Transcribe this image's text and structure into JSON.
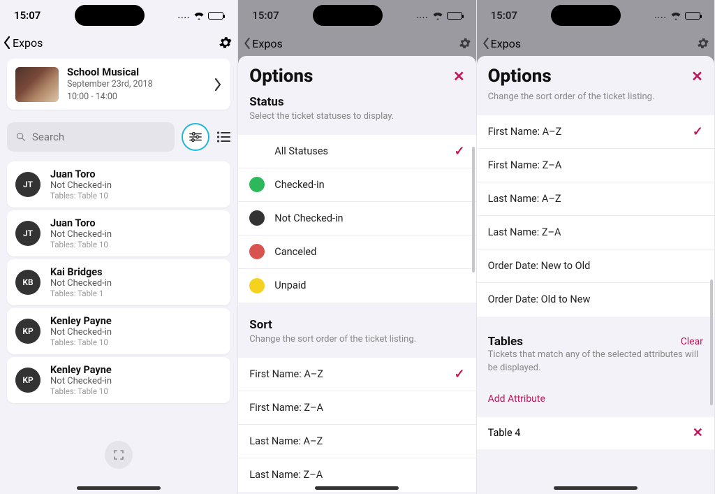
{
  "time": "15:07",
  "dots": "....",
  "screen1": {
    "back_label": "Expos",
    "event": {
      "title": "School Musical",
      "date": "September 23rd, 2018",
      "time": "10:00 - 14:00"
    },
    "search_placeholder": "Search",
    "attendees": [
      {
        "initials": "JT",
        "name": "Juan Toro",
        "status": "Not Checked-in",
        "table": "Tables: Table 10"
      },
      {
        "initials": "JT",
        "name": "Juan Toro",
        "status": "Not Checked-in",
        "table": "Tables: Table 10"
      },
      {
        "initials": "KB",
        "name": "Kai Bridges",
        "status": "Not Checked-in",
        "table": "Tables: Table 1"
      },
      {
        "initials": "KP",
        "name": "Kenley Payne",
        "status": "Not Checked-in",
        "table": "Tables: Table 10"
      },
      {
        "initials": "KP",
        "name": "Kenley Payne",
        "status": "Not Checked-in",
        "table": "Tables: Table 10"
      }
    ]
  },
  "screen2": {
    "back_label": "Expos",
    "sheet_title": "Options",
    "status_title": "Status",
    "status_sub": "Select the ticket statuses to display.",
    "status_opts": [
      {
        "label": "All Statuses",
        "color": "none",
        "selected": true
      },
      {
        "label": "Checked-in",
        "color": "green",
        "selected": false
      },
      {
        "label": "Not Checked-in",
        "color": "black",
        "selected": false
      },
      {
        "label": "Canceled",
        "color": "red",
        "selected": false
      },
      {
        "label": "Unpaid",
        "color": "yellow",
        "selected": false
      }
    ],
    "sort_title": "Sort",
    "sort_sub": "Change the sort order of the ticket listing.",
    "sort_opts": [
      {
        "label": "First Name: A–Z",
        "selected": true
      },
      {
        "label": "First Name: Z–A",
        "selected": false
      },
      {
        "label": "Last Name: A–Z",
        "selected": false
      },
      {
        "label": "Last Name: Z–A",
        "selected": false
      }
    ]
  },
  "screen3": {
    "back_label": "Expos",
    "sheet_title": "Options",
    "sort_sub": "Change the sort order of the ticket listing.",
    "sort_opts": [
      {
        "label": "First Name: A–Z",
        "selected": true
      },
      {
        "label": "First Name: Z–A",
        "selected": false
      },
      {
        "label": "Last Name: A–Z",
        "selected": false
      },
      {
        "label": "Last Name: Z–A",
        "selected": false
      },
      {
        "label": "Order Date: New to Old",
        "selected": false
      },
      {
        "label": "Order Date: Old to New",
        "selected": false
      }
    ],
    "tables_title": "Tables",
    "clear_label": "Clear",
    "tables_sub": "Tickets that match any of the selected attributes will be displayed.",
    "add_attr": "Add Attribute",
    "attr_selected": "Table 4"
  }
}
